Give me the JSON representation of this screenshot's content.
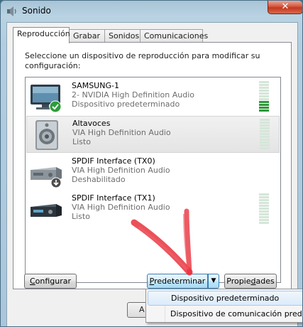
{
  "window": {
    "title": "Sonido",
    "title_icon": "speaker-icon",
    "close_glyph": "✕"
  },
  "tabs": [
    {
      "label": "Reproducción",
      "active": true
    },
    {
      "label": "Grabar",
      "active": false
    },
    {
      "label": "Sonidos",
      "active": false
    },
    {
      "label": "Comunicaciones",
      "active": false
    }
  ],
  "instruction": "Seleccione un dispositivo de reproducción para modificar su configuración:",
  "devices": [
    {
      "name": "SAMSUNG-1",
      "driver": "2- NVIDIA High Definition Audio",
      "status": "Dispositivo predeterminado",
      "icon": "monitor-icon",
      "badge": "check-icon",
      "meter_level": 0.35
    },
    {
      "name": "Altavoces",
      "driver": "VIA High Definition Audio",
      "status": "Listo",
      "icon": "speaker-icon",
      "badge": "",
      "meter_level": 0
    },
    {
      "name": "SPDIF Interface (TX0)",
      "driver": "VIA High Definition Audio",
      "status": "Deshabilitado",
      "icon": "receiver-icon",
      "badge": "disabled-arrow-icon",
      "meter_level": 0
    },
    {
      "name": "SPDIF Interface (TX1)",
      "driver": "VIA High Definition Audio",
      "status": "Listo",
      "icon": "receiver-icon",
      "badge": "",
      "meter_level": 0
    }
  ],
  "buttons": {
    "configure": {
      "pre": "",
      "accel": "C",
      "post": "onfigurar"
    },
    "set_default": {
      "pre": "",
      "accel": "P",
      "post": "redeterminar"
    },
    "properties": {
      "pre": "Propie",
      "accel": "d",
      "post": "ades"
    },
    "dropdown_arrow": "▼",
    "behind": "A"
  },
  "dropdown_menu": [
    {
      "label": "Dispositivo predeterminado",
      "highlighted": true
    },
    {
      "label": "Dispositivo de comunicación predet",
      "highlighted": false
    }
  ],
  "colors": {
    "accent": "#3c7fb1",
    "meter_on": "#2f9a3c",
    "annotation_arrow": "#e8323c"
  }
}
